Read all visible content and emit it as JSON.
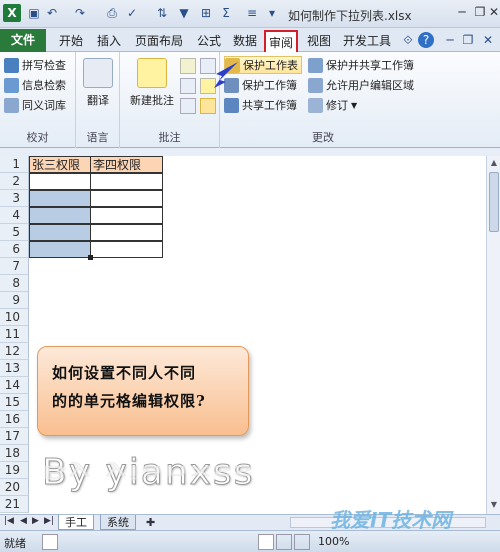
{
  "window": {
    "title": "如何制作下拉列表.xlsx"
  },
  "tabs": [
    "文件",
    "开始",
    "插入",
    "页面布局",
    "公式",
    "数据",
    "审阅",
    "视图",
    "开发工具"
  ],
  "active_tab": "审阅",
  "ribbon": {
    "proofing": {
      "items": [
        "拼写检查",
        "信息检索",
        "同义词库"
      ],
      "label": "校对"
    },
    "language": {
      "button": "翻译",
      "label": "语言"
    },
    "comments": {
      "button": "新建批注",
      "label": "批注"
    },
    "changes": {
      "items": [
        "保护工作表",
        "保护并共享工作簿",
        "保护工作簿",
        "允许用户编辑区域",
        "共享工作簿",
        "修订"
      ],
      "label": "更改"
    }
  },
  "sheet": {
    "headers": [
      "张三权限",
      "李四权限"
    ],
    "row_numbers": [
      "1",
      "2",
      "3",
      "4",
      "5",
      "6",
      "7",
      "8",
      "9",
      "10",
      "11",
      "12",
      "13",
      "14",
      "15",
      "16",
      "17",
      "18",
      "19",
      "20",
      "21"
    ]
  },
  "callout": {
    "line1": "如何设置不同人不同",
    "line2": "的的单元格编辑权限?"
  },
  "watermark": "By yianxss",
  "sheet_tabs": [
    "手工",
    "系统"
  ],
  "status": {
    "ready": "就绪",
    "zoom": "100%"
  },
  "site_logo": "我爱IT技术网",
  "colors": {
    "file_tab": "#2a7a3b",
    "highlight_border": "#d21f2c",
    "header_fill": "#fcd5b4",
    "selection": "#b8cce4",
    "callout": "#f9bf8f"
  }
}
